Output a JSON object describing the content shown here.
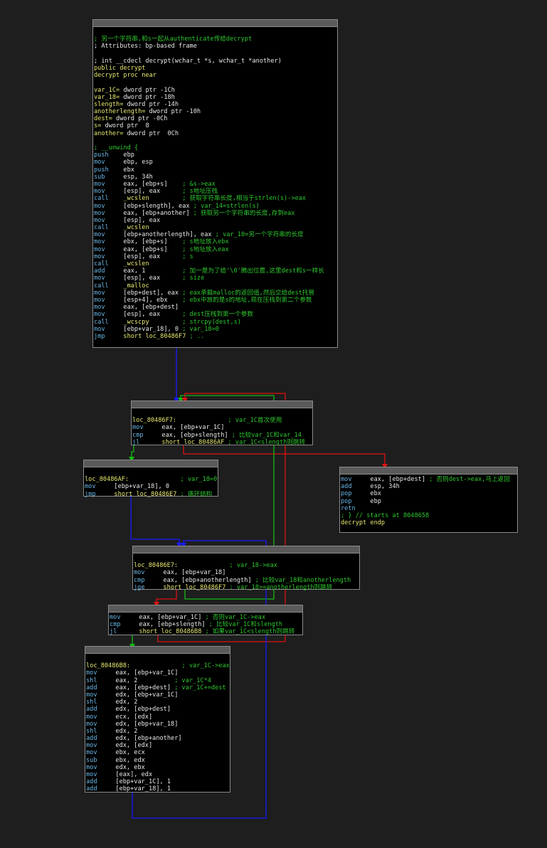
{
  "colors": {
    "background": "#1e1e1e",
    "block": "#000000",
    "comment": "#2fc82f",
    "edge_true": "#00aa00",
    "edge_false": "#cc0000",
    "edge_uncond": "#0000cc"
  },
  "blocks": [
    {
      "id": "b0",
      "lines": [
        [],
        [
          [
            "c",
            "; 另一个字符串,和s一起从authenticate传给decrypt"
          ]
        ],
        [
          [
            "o",
            "; Attributes: bp-based frame"
          ]
        ],
        [],
        [
          [
            "o",
            "; int __cdecl decrypt(wchar_t *s, wchar_t *another)"
          ]
        ],
        [
          [
            "lb",
            "public decrypt"
          ]
        ],
        [
          [
            "lb",
            "decrypt proc near"
          ]
        ],
        [],
        [
          [
            "lb",
            "var_1C= "
          ],
          [
            "o",
            "dword ptr -1Ch"
          ]
        ],
        [
          [
            "lb",
            "var_18= "
          ],
          [
            "o",
            "dword ptr -18h"
          ]
        ],
        [
          [
            "lb",
            "slength= "
          ],
          [
            "o",
            "dword ptr -14h"
          ]
        ],
        [
          [
            "lb",
            "anotherlength= "
          ],
          [
            "o",
            "dword ptr -10h"
          ]
        ],
        [
          [
            "lb",
            "dest= "
          ],
          [
            "o",
            "dword ptr -0Ch"
          ]
        ],
        [
          [
            "lb",
            "s= "
          ],
          [
            "o",
            "dword ptr  8"
          ]
        ],
        [
          [
            "lb",
            "another= "
          ],
          [
            "o",
            "dword ptr  0Ch"
          ]
        ],
        [],
        [
          [
            "c",
            "; __unwind {"
          ]
        ],
        [
          [
            "m",
            "push    "
          ],
          [
            "o",
            "ebp"
          ]
        ],
        [
          [
            "m",
            "mov     "
          ],
          [
            "o",
            "ebp, esp"
          ]
        ],
        [
          [
            "m",
            "push    "
          ],
          [
            "o",
            "ebx"
          ]
        ],
        [
          [
            "m",
            "sub     "
          ],
          [
            "o",
            "esp, 34h"
          ]
        ],
        [
          [
            "m",
            "mov     "
          ],
          [
            "o",
            "eax, [ebp+s]    "
          ],
          [
            "c",
            "; &s->eax"
          ]
        ],
        [
          [
            "m",
            "mov     "
          ],
          [
            "o",
            "[esp], eax      "
          ],
          [
            "c",
            "; s地址压栈"
          ]
        ],
        [
          [
            "m",
            "call    "
          ],
          [
            "lb",
            "_wcslen         "
          ],
          [
            "c",
            "; 获取字符串长度,相当于strlen(s)->eax"
          ]
        ],
        [
          [
            "m",
            "mov     "
          ],
          [
            "o",
            "[ebp+slength], eax "
          ],
          [
            "c",
            "; var_14=strlen(s)"
          ]
        ],
        [
          [
            "m",
            "mov     "
          ],
          [
            "o",
            "eax, [ebp+another] "
          ],
          [
            "c",
            "; 获取另一个字符串的长度,存到eax"
          ]
        ],
        [
          [
            "m",
            "mov     "
          ],
          [
            "o",
            "[esp], eax"
          ]
        ],
        [
          [
            "m",
            "call    "
          ],
          [
            "lb",
            "_wcslen"
          ]
        ],
        [
          [
            "m",
            "mov     "
          ],
          [
            "o",
            "[ebp+anotherlength], eax "
          ],
          [
            "c",
            "; var_10=另一个字符串的长度"
          ]
        ],
        [
          [
            "m",
            "mov     "
          ],
          [
            "o",
            "ebx, [ebp+s]    "
          ],
          [
            "c",
            "; s地址放入ebx"
          ]
        ],
        [
          [
            "m",
            "mov     "
          ],
          [
            "o",
            "eax, [ebp+s]    "
          ],
          [
            "c",
            "; s地址放入eax"
          ]
        ],
        [
          [
            "m",
            "mov     "
          ],
          [
            "o",
            "[esp], eax      "
          ],
          [
            "c",
            "; s"
          ]
        ],
        [
          [
            "m",
            "call    "
          ],
          [
            "lb",
            "_wcslen"
          ]
        ],
        [
          [
            "m",
            "add     "
          ],
          [
            "o",
            "eax, 1          "
          ],
          [
            "c",
            "; 加一是为了给'\\0'腾出位置,这里dest和s一样长"
          ]
        ],
        [
          [
            "m",
            "mov     "
          ],
          [
            "o",
            "[esp], eax      "
          ],
          [
            "c",
            "; size"
          ]
        ],
        [
          [
            "m",
            "call    "
          ],
          [
            "lb",
            "_malloc"
          ]
        ],
        [
          [
            "m",
            "mov     "
          ],
          [
            "o",
            "[ebp+dest], eax "
          ],
          [
            "c",
            "; eax承载malloc的返回值,然后交给dest托管"
          ]
        ],
        [
          [
            "m",
            "mov     "
          ],
          [
            "o",
            "[esp+4], ebx    "
          ],
          [
            "c",
            "; ebx中放的是s的地址,现在压栈到第二个参数"
          ]
        ],
        [
          [
            "m",
            "mov     "
          ],
          [
            "o",
            "eax, [ebp+dest]"
          ]
        ],
        [
          [
            "m",
            "mov     "
          ],
          [
            "o",
            "[esp], eax      "
          ],
          [
            "c",
            "; dest压栈到第一个参数"
          ]
        ],
        [
          [
            "m",
            "call    "
          ],
          [
            "lb",
            "_wcscpy         "
          ],
          [
            "c",
            "; strcpy(dest,s)"
          ]
        ],
        [
          [
            "m",
            "mov     "
          ],
          [
            "o",
            "[ebp+var_18], 0 "
          ],
          [
            "c",
            "; var_18=0"
          ]
        ],
        [
          [
            "m",
            "jmp     "
          ],
          [
            "lb",
            "short loc_80486F7 "
          ],
          [
            "c",
            "; .."
          ]
        ]
      ]
    },
    {
      "id": "b1",
      "lines": [
        [],
        [
          [
            "lb",
            "loc_80486F7:              "
          ],
          [
            "c",
            "; var_1C首次使用"
          ]
        ],
        [
          [
            "m",
            "mov     "
          ],
          [
            "o",
            "eax, [ebp+var_1C]"
          ]
        ],
        [
          [
            "m",
            "cmp     "
          ],
          [
            "o",
            "eax, [ebp+slength] "
          ],
          [
            "c",
            "; 比较var_1C和var_14"
          ]
        ],
        [
          [
            "m",
            "jl      "
          ],
          [
            "lb",
            "short loc_80486AF "
          ],
          [
            "c",
            "; var_1C<slength则跳转"
          ]
        ]
      ]
    },
    {
      "id": "b2",
      "lines": [
        [],
        [
          [
            "lb",
            "loc_80486AF:              "
          ],
          [
            "c",
            "; var_18=0"
          ]
        ],
        [
          [
            "m",
            "mov     "
          ],
          [
            "o",
            "[ebp+var_18], 0"
          ]
        ],
        [
          [
            "m",
            "jmp     "
          ],
          [
            "lb",
            "short loc_80486E7 "
          ],
          [
            "c",
            "; 循环结构"
          ]
        ]
      ]
    },
    {
      "id": "b3",
      "lines": [
        [
          [
            "m",
            "mov     "
          ],
          [
            "o",
            "eax, [ebp+dest] "
          ],
          [
            "c",
            "; 否则dest->eax,马上返回"
          ]
        ],
        [
          [
            "m",
            "add     "
          ],
          [
            "o",
            "esp, 34h"
          ]
        ],
        [
          [
            "m",
            "pop     "
          ],
          [
            "o",
            "ebx"
          ]
        ],
        [
          [
            "m",
            "pop     "
          ],
          [
            "o",
            "ebp"
          ]
        ],
        [
          [
            "m",
            "retn"
          ]
        ],
        [
          [
            "c",
            "; } // starts at 8048658"
          ]
        ],
        [
          [
            "lb",
            "decrypt endp"
          ]
        ]
      ]
    },
    {
      "id": "b4",
      "lines": [
        [],
        [
          [
            "lb",
            "loc_80486E7:              "
          ],
          [
            "c",
            "; var_18->eax"
          ]
        ],
        [
          [
            "m",
            "mov     "
          ],
          [
            "o",
            "eax, [ebp+var_18]"
          ]
        ],
        [
          [
            "m",
            "cmp     "
          ],
          [
            "o",
            "eax, [ebp+anotherlength] "
          ],
          [
            "c",
            "; 比较var_18和anotherlength"
          ]
        ],
        [
          [
            "m",
            "jge     "
          ],
          [
            "lb",
            "short loc_80486F7 "
          ],
          [
            "c",
            "; var_18>=anotherlength则跳转"
          ]
        ]
      ]
    },
    {
      "id": "b5",
      "lines": [
        [
          [
            "m",
            "mov     "
          ],
          [
            "o",
            "eax, [ebp+var_1C] "
          ],
          [
            "c",
            "; 否则var_1C->eax"
          ]
        ],
        [
          [
            "m",
            "cmp     "
          ],
          [
            "o",
            "eax, [ebp+slength] "
          ],
          [
            "c",
            "; 比较var_1C和slength"
          ]
        ],
        [
          [
            "m",
            "jl      "
          ],
          [
            "lb",
            "short loc_80486B8 "
          ],
          [
            "c",
            "; 如果var_1C<slength则跳转"
          ]
        ]
      ]
    },
    {
      "id": "b6",
      "lines": [
        [],
        [
          [
            "lb",
            "loc_80486B8:              "
          ],
          [
            "c",
            "; var_1C->eax"
          ]
        ],
        [
          [
            "m",
            "mov     "
          ],
          [
            "o",
            "eax, [ebp+var_1C]"
          ]
        ],
        [
          [
            "m",
            "shl     "
          ],
          [
            "o",
            "eax, 2          "
          ],
          [
            "c",
            "; var_1C*4"
          ]
        ],
        [
          [
            "m",
            "add     "
          ],
          [
            "o",
            "eax, [ebp+dest] "
          ],
          [
            "c",
            "; var_1C+=dest"
          ]
        ],
        [
          [
            "m",
            "mov     "
          ],
          [
            "o",
            "edx, [ebp+var_1C]"
          ]
        ],
        [
          [
            "m",
            "shl     "
          ],
          [
            "o",
            "edx, 2"
          ]
        ],
        [
          [
            "m",
            "add     "
          ],
          [
            "o",
            "edx, [ebp+dest]"
          ]
        ],
        [
          [
            "m",
            "mov     "
          ],
          [
            "o",
            "ecx, [edx]"
          ]
        ],
        [
          [
            "m",
            "mov     "
          ],
          [
            "o",
            "edx, [ebp+var_18]"
          ]
        ],
        [
          [
            "m",
            "shl     "
          ],
          [
            "o",
            "edx, 2"
          ]
        ],
        [
          [
            "m",
            "add     "
          ],
          [
            "o",
            "edx, [ebp+another]"
          ]
        ],
        [
          [
            "m",
            "mov     "
          ],
          [
            "o",
            "edx, [edx]"
          ]
        ],
        [
          [
            "m",
            "mov     "
          ],
          [
            "o",
            "ebx, ecx"
          ]
        ],
        [
          [
            "m",
            "sub     "
          ],
          [
            "o",
            "ebx, edx"
          ]
        ],
        [
          [
            "m",
            "mov     "
          ],
          [
            "o",
            "edx, ebx"
          ]
        ],
        [
          [
            "m",
            "mov     "
          ],
          [
            "o",
            "[eax], edx"
          ]
        ],
        [
          [
            "m",
            "add     "
          ],
          [
            "o",
            "[ebp+var_1C], 1"
          ]
        ],
        [
          [
            "m",
            "add     "
          ],
          [
            "o",
            "[ebp+var_18], 1"
          ]
        ]
      ]
    }
  ]
}
